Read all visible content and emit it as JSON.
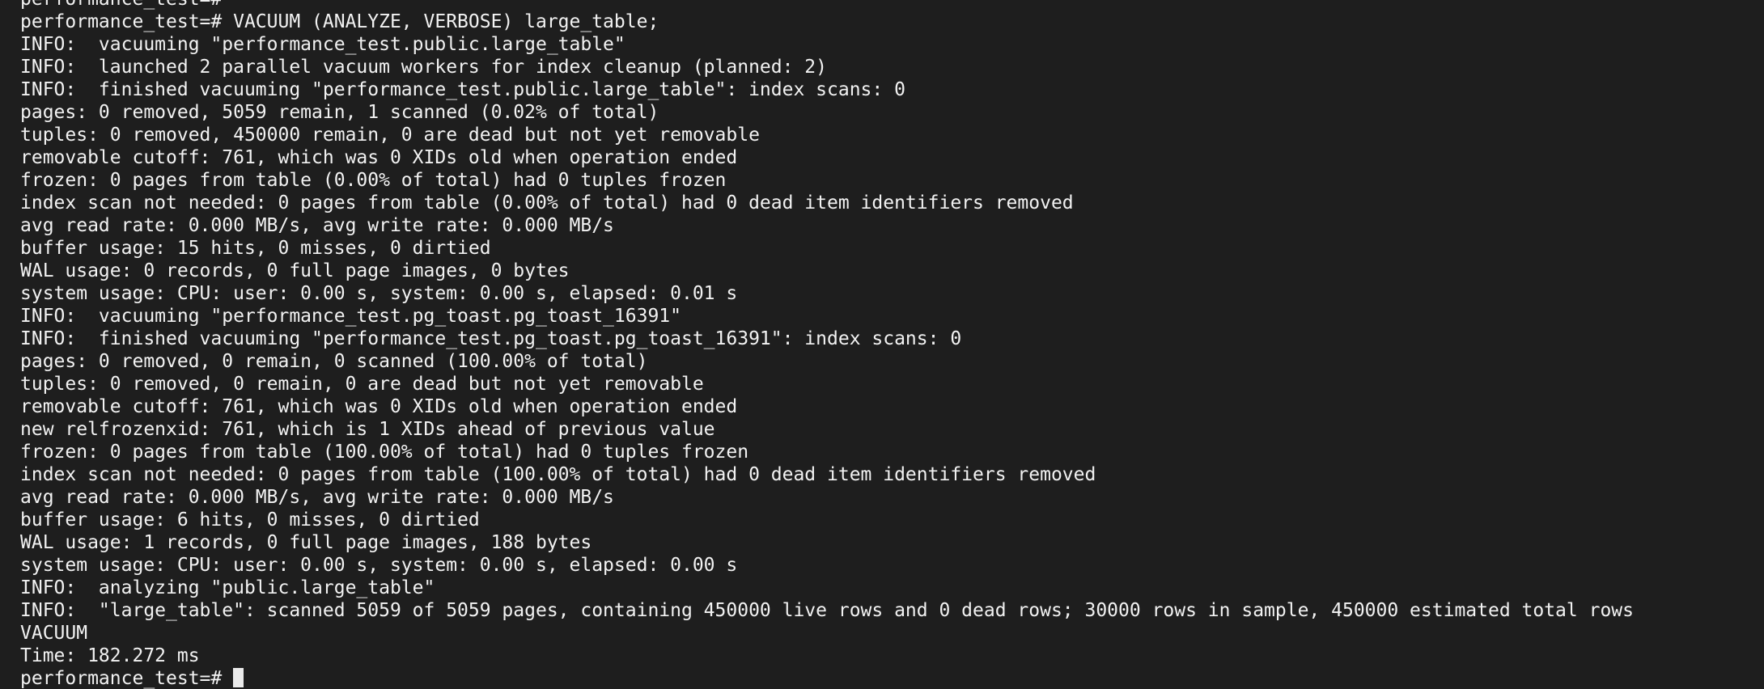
{
  "terminal": {
    "prompt": "performance_test=# ",
    "lines": [
      "performance_test=#",
      "performance_test=# VACUUM (ANALYZE, VERBOSE) large_table;",
      "INFO:  vacuuming \"performance_test.public.large_table\"",
      "INFO:  launched 2 parallel vacuum workers for index cleanup (planned: 2)",
      "INFO:  finished vacuuming \"performance_test.public.large_table\": index scans: 0",
      "pages: 0 removed, 5059 remain, 1 scanned (0.02% of total)",
      "tuples: 0 removed, 450000 remain, 0 are dead but not yet removable",
      "removable cutoff: 761, which was 0 XIDs old when operation ended",
      "frozen: 0 pages from table (0.00% of total) had 0 tuples frozen",
      "index scan not needed: 0 pages from table (0.00% of total) had 0 dead item identifiers removed",
      "avg read rate: 0.000 MB/s, avg write rate: 0.000 MB/s",
      "buffer usage: 15 hits, 0 misses, 0 dirtied",
      "WAL usage: 0 records, 0 full page images, 0 bytes",
      "system usage: CPU: user: 0.00 s, system: 0.00 s, elapsed: 0.01 s",
      "INFO:  vacuuming \"performance_test.pg_toast.pg_toast_16391\"",
      "INFO:  finished vacuuming \"performance_test.pg_toast.pg_toast_16391\": index scans: 0",
      "pages: 0 removed, 0 remain, 0 scanned (100.00% of total)",
      "tuples: 0 removed, 0 remain, 0 are dead but not yet removable",
      "removable cutoff: 761, which was 0 XIDs old when operation ended",
      "new relfrozenxid: 761, which is 1 XIDs ahead of previous value",
      "frozen: 0 pages from table (100.00% of total) had 0 tuples frozen",
      "index scan not needed: 0 pages from table (100.00% of total) had 0 dead item identifiers removed",
      "avg read rate: 0.000 MB/s, avg write rate: 0.000 MB/s",
      "buffer usage: 6 hits, 0 misses, 0 dirtied",
      "WAL usage: 1 records, 0 full page images, 188 bytes",
      "system usage: CPU: user: 0.00 s, system: 0.00 s, elapsed: 0.00 s",
      "INFO:  analyzing \"public.large_table\"",
      "INFO:  \"large_table\": scanned 5059 of 5059 pages, containing 450000 live rows and 0 dead rows; 30000 rows in sample, 450000 estimated total rows",
      "VACUUM",
      "Time: 182.272 ms"
    ]
  }
}
